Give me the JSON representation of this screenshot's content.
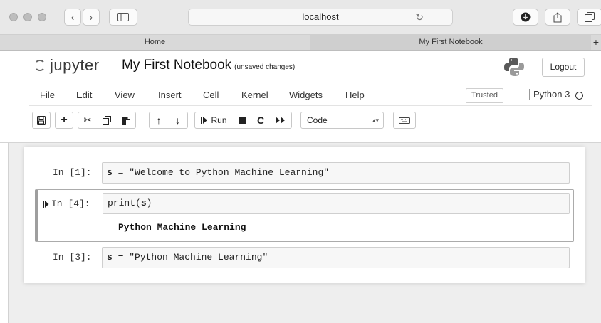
{
  "browser": {
    "address": "localhost",
    "tabs": [
      {
        "label": "Home",
        "active": false
      },
      {
        "label": "My First Notebook",
        "active": true
      }
    ],
    "new_tab_label": "+"
  },
  "header": {
    "logo_text": "jupyter",
    "notebook_title": "My First Notebook",
    "save_status": "(unsaved changes)",
    "logout_label": "Logout"
  },
  "menu": {
    "items": [
      "File",
      "Edit",
      "View",
      "Insert",
      "Cell",
      "Kernel",
      "Widgets",
      "Help"
    ],
    "trusted": "Trusted",
    "kernel_name": "Python 3"
  },
  "toolbar": {
    "run_label": "Run",
    "cell_type": "Code",
    "icons": [
      "save-icon",
      "plus-icon",
      "cut-icon",
      "copy-icon",
      "paste-icon",
      "arrow-up-icon",
      "arrow-down-icon",
      "run-icon",
      "stop-icon",
      "restart-icon",
      "fast-forward-icon",
      "keyboard-icon"
    ]
  },
  "cells": [
    {
      "prompt": "In [1]:",
      "code_var": "s",
      "code_rest": " = \"Welcome to Python Machine Learning\"",
      "output": "",
      "selected": false
    },
    {
      "prompt": "In [4]:",
      "code_pre": "print(",
      "code_var": "s",
      "code_post": ")",
      "output": "Python Machine Learning",
      "selected": true
    },
    {
      "prompt": "In [3]:",
      "code_var": "s",
      "code_rest": " = \"Python Machine Learning\"",
      "output": "",
      "selected": false
    }
  ]
}
